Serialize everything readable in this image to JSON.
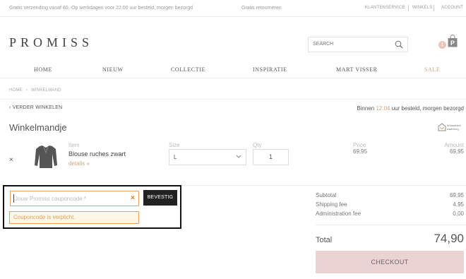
{
  "topbar": {
    "messages": [
      "Gratis verzending vanaf 80,-",
      "Op werkdagen voor 22:00 uur besteld, morgen bezorgd",
      "Gratis retourneren"
    ],
    "links": [
      "KLANTENSERVICE",
      "WINKELS",
      "ACCOUNT"
    ]
  },
  "logo": "PROMISS",
  "search": {
    "placeholder": "SEARCH"
  },
  "cart_badge": "1",
  "nav": [
    "HOME",
    "NIEUW",
    "COLLECTIE",
    "INSPIRATIE",
    "MART VISSER",
    "SALE"
  ],
  "breadcrumb": [
    "HOME",
    "›",
    "WINKELMAND"
  ],
  "back_link": "VERDER WINKELEN",
  "delivery": {
    "pre": "Binnen ",
    "time": "12:04",
    "post": " uur besteld, morgen bezorgd"
  },
  "cart_title": "Winkelmandje",
  "trust_badge": {
    "line1": "thuiswinkel",
    "line2": "waarborg"
  },
  "labels": {
    "item": "Item",
    "size": "Size",
    "qty": "Qty",
    "price": "Price",
    "amount": "Amount"
  },
  "product": {
    "remove": "×",
    "name": "Blouse ruches zwart",
    "details": "details »",
    "size": "L",
    "qty": "1",
    "price": "69,95",
    "amount": "69,95"
  },
  "coupon": {
    "placeholder": "Jouw Promiss couponcode *",
    "clear": "×",
    "confirm": "BEVESTIG",
    "error": "Couponcode is verplicht."
  },
  "summary": {
    "rows": [
      {
        "label": "Subtotal",
        "value": "69,95"
      },
      {
        "label": "Shipping fee",
        "value": "4,95"
      },
      {
        "label": "Administration fee",
        "value": "0,00"
      }
    ],
    "total_label": "Total",
    "total_value": "74,90",
    "checkout": "CHECKOUT"
  },
  "colors": {
    "accent": "#d3a47c",
    "error": "#e2a263",
    "checkout_bg": "#ecd3d3",
    "badge": "#f0c3b6"
  }
}
